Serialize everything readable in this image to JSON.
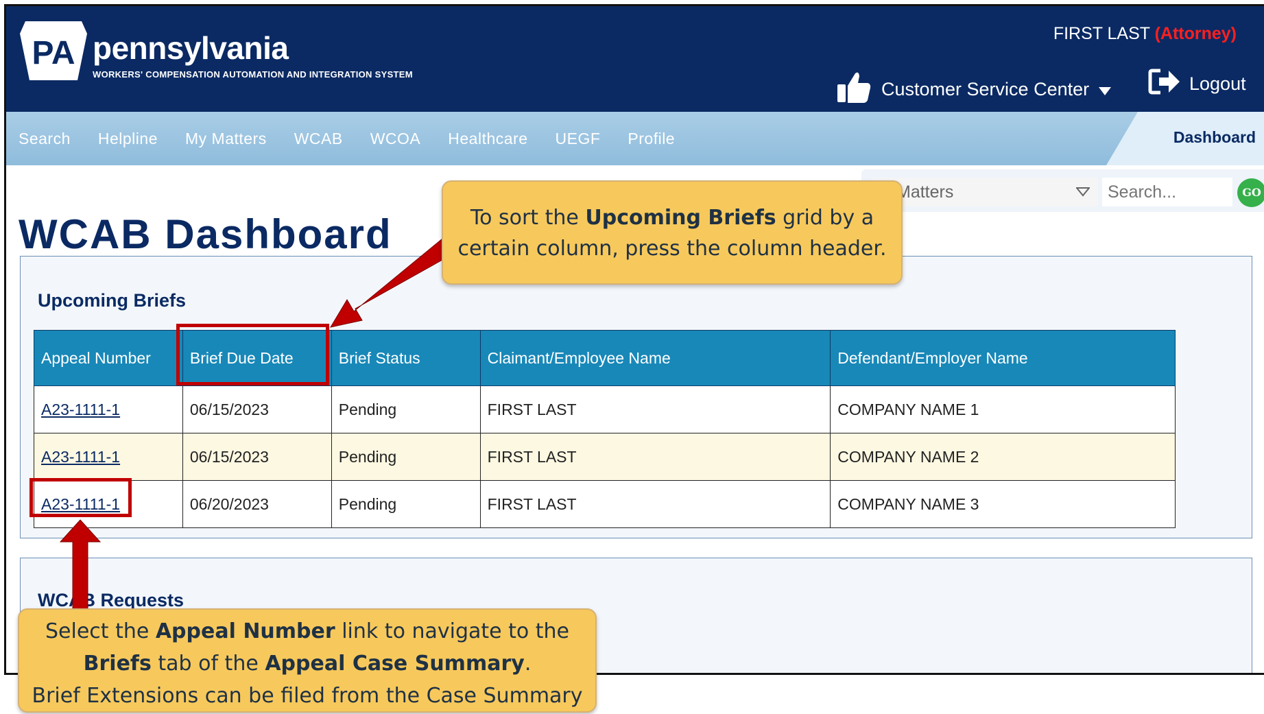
{
  "header": {
    "brand_name": "pennsylvania",
    "logo_text": "PA",
    "subtitle": "WORKERS' COMPENSATION AUTOMATION AND INTEGRATION SYSTEM",
    "user_name": "FIRST LAST",
    "user_role": "(Attorney)",
    "csc_label": "Customer Service Center",
    "logout_label": "Logout"
  },
  "nav": {
    "items": [
      "Search",
      "Helpline",
      "My Matters",
      "WCAB",
      "WCOA",
      "Healthcare",
      "UEGF",
      "Profile"
    ],
    "dashboard_label": "Dashboard"
  },
  "search": {
    "select_value": "Matters",
    "placeholder": "Search...",
    "go_label": "GO"
  },
  "page": {
    "title": "WCAB Dashboard"
  },
  "upcoming_briefs": {
    "title": "Upcoming Briefs",
    "columns": [
      "Appeal Number",
      "Brief Due Date",
      "Brief Status",
      "Claimant/Employee Name",
      "Defendant/Employer Name"
    ],
    "rows": [
      {
        "appeal": "A23-1111-1",
        "due": "06/15/2023",
        "status": "Pending",
        "claimant": "FIRST LAST",
        "defendant": "COMPANY NAME 1"
      },
      {
        "appeal": "A23-1111-1",
        "due": "06/15/2023",
        "status": "Pending",
        "claimant": "FIRST LAST",
        "defendant": "COMPANY NAME 2"
      },
      {
        "appeal": "A23-1111-1",
        "due": "06/20/2023",
        "status": "Pending",
        "claimant": "FIRST LAST",
        "defendant": "COMPANY NAME 3"
      }
    ]
  },
  "wcab_requests": {
    "title": "WCAB Requests"
  },
  "callouts": {
    "sort": {
      "p1": "To sort the ",
      "b1": "Upcoming Briefs",
      "p2": " grid by a",
      "line2": "certain column, press the column header."
    },
    "appeal": {
      "p1": "Select the ",
      "b1": "Appeal Number",
      "p2": " link to navigate to the",
      "b2": "Briefs",
      "p3": " tab of the ",
      "b3": "Appeal Case Summary",
      "p4": ".",
      "line3": "Brief Extensions can be filed from the Case Summary"
    }
  },
  "colors": {
    "header_bg": "#0b2a63",
    "nav_bg": "#a9cde6",
    "table_header": "#1888b8",
    "highlight": "#c00000",
    "callout_bg": "#f7c95c"
  }
}
